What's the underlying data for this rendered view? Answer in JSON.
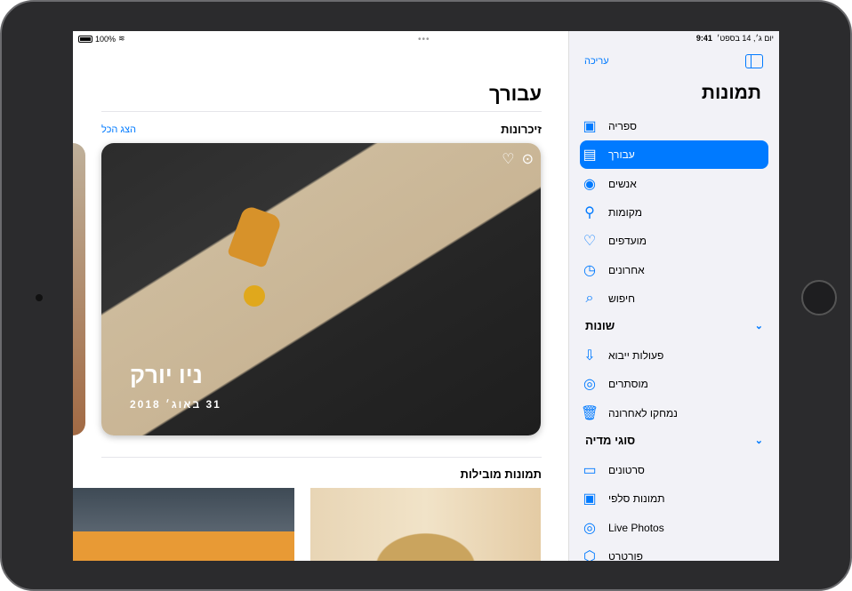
{
  "status": {
    "battery": "100%",
    "time": "9:41",
    "date": "יום ג׳, 14 בספט׳"
  },
  "main": {
    "title": "עבורך",
    "memories": {
      "header": "זיכרונות",
      "see_all": "הצג הכל",
      "card": {
        "title": "ניו יורק",
        "date": "31 באוג׳ 2018"
      }
    },
    "featured": {
      "header": "תמונות מובילות"
    }
  },
  "sidebar": {
    "edit": "עריכה",
    "title": "תמונות",
    "items": [
      {
        "label": "ספריה",
        "icon": "photo-library-icon",
        "glyph": "▣"
      },
      {
        "label": "עבורך",
        "icon": "for-you-icon",
        "glyph": "▤",
        "selected": true
      },
      {
        "label": "אנשים",
        "icon": "person-circle-icon",
        "glyph": "◉"
      },
      {
        "label": "מקומות",
        "icon": "map-pin-icon",
        "glyph": "⚲"
      },
      {
        "label": "מועדפים",
        "icon": "heart-icon",
        "glyph": "♡"
      },
      {
        "label": "אחרונים",
        "icon": "clock-icon",
        "glyph": "◷"
      },
      {
        "label": "חיפוש",
        "icon": "search-icon",
        "glyph": "⌕"
      }
    ],
    "groups": [
      {
        "label": "שונות",
        "items": [
          {
            "label": "פעולות ייבוא",
            "icon": "import-icon",
            "glyph": "⇩"
          },
          {
            "label": "מוסתרים",
            "icon": "eye-slash-icon",
            "glyph": "◎"
          },
          {
            "label": "נמחקו לאחרונה",
            "icon": "trash-icon",
            "glyph": "🗑"
          }
        ]
      },
      {
        "label": "סוגי מדיה",
        "items": [
          {
            "label": "סרטונים",
            "icon": "video-icon",
            "glyph": "▭"
          },
          {
            "label": "תמונות סלפי",
            "icon": "selfie-icon",
            "glyph": "▣"
          },
          {
            "label": "Live Photos",
            "icon": "live-photo-icon",
            "glyph": "◎"
          },
          {
            "label": "פורטרט",
            "icon": "cube-icon",
            "glyph": "⬡"
          }
        ]
      }
    ]
  },
  "colors": {
    "accent": "#007aff"
  }
}
